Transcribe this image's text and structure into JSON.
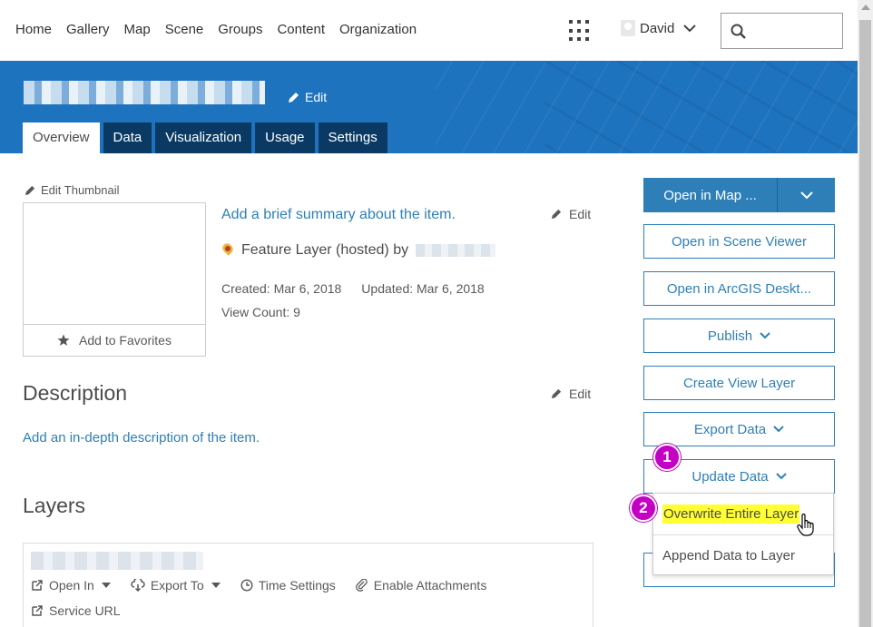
{
  "nav": {
    "links": [
      "Home",
      "Gallery",
      "Map",
      "Scene",
      "Groups",
      "Content",
      "Organization"
    ],
    "user_name": "David",
    "search_placeholder": ""
  },
  "banner": {
    "title": "",
    "edit_label": "Edit",
    "tabs": [
      "Overview",
      "Data",
      "Visualization",
      "Usage",
      "Settings"
    ],
    "active_tab": "Overview"
  },
  "overview": {
    "edit_thumbnail_label": "Edit Thumbnail",
    "add_favorites_label": "Add to Favorites",
    "summary_placeholder": "Add a brief summary about the item.",
    "summary_edit_label": "Edit",
    "item_type": "Feature Layer (hosted) by",
    "created_label": "Created: Mar 6, 2018",
    "updated_label": "Updated: Mar 6, 2018",
    "view_count_label": "View Count: 9"
  },
  "description": {
    "title": "Description",
    "edit_label": "Edit",
    "placeholder": "Add an in-depth description of the item."
  },
  "layers": {
    "title": "Layers",
    "layer_name": "",
    "actions": [
      "Open In",
      "Export To",
      "Time Settings",
      "Enable Attachments"
    ],
    "service_url_label": "Service URL"
  },
  "actions": {
    "open_in_map": "Open in Map ...",
    "open_scene_viewer": "Open in Scene Viewer",
    "open_arcgis_desktop": "Open in ArcGIS Deskt...",
    "publish": "Publish",
    "create_view_layer": "Create View Layer",
    "export_data": "Export Data",
    "update_data": "Update Data",
    "menu": {
      "overwrite": "Overwrite Entire Layer",
      "append": "Append Data to Layer"
    }
  },
  "annotations": {
    "badge_1": "1",
    "badge_2": "2"
  },
  "colors": {
    "accent_blue": "#2e7fb8",
    "banner_blue": "#1e73be",
    "tab_dark": "#0a3a63",
    "highlight_yellow": "#ffff33",
    "badge_magenta": "#c400c4"
  }
}
